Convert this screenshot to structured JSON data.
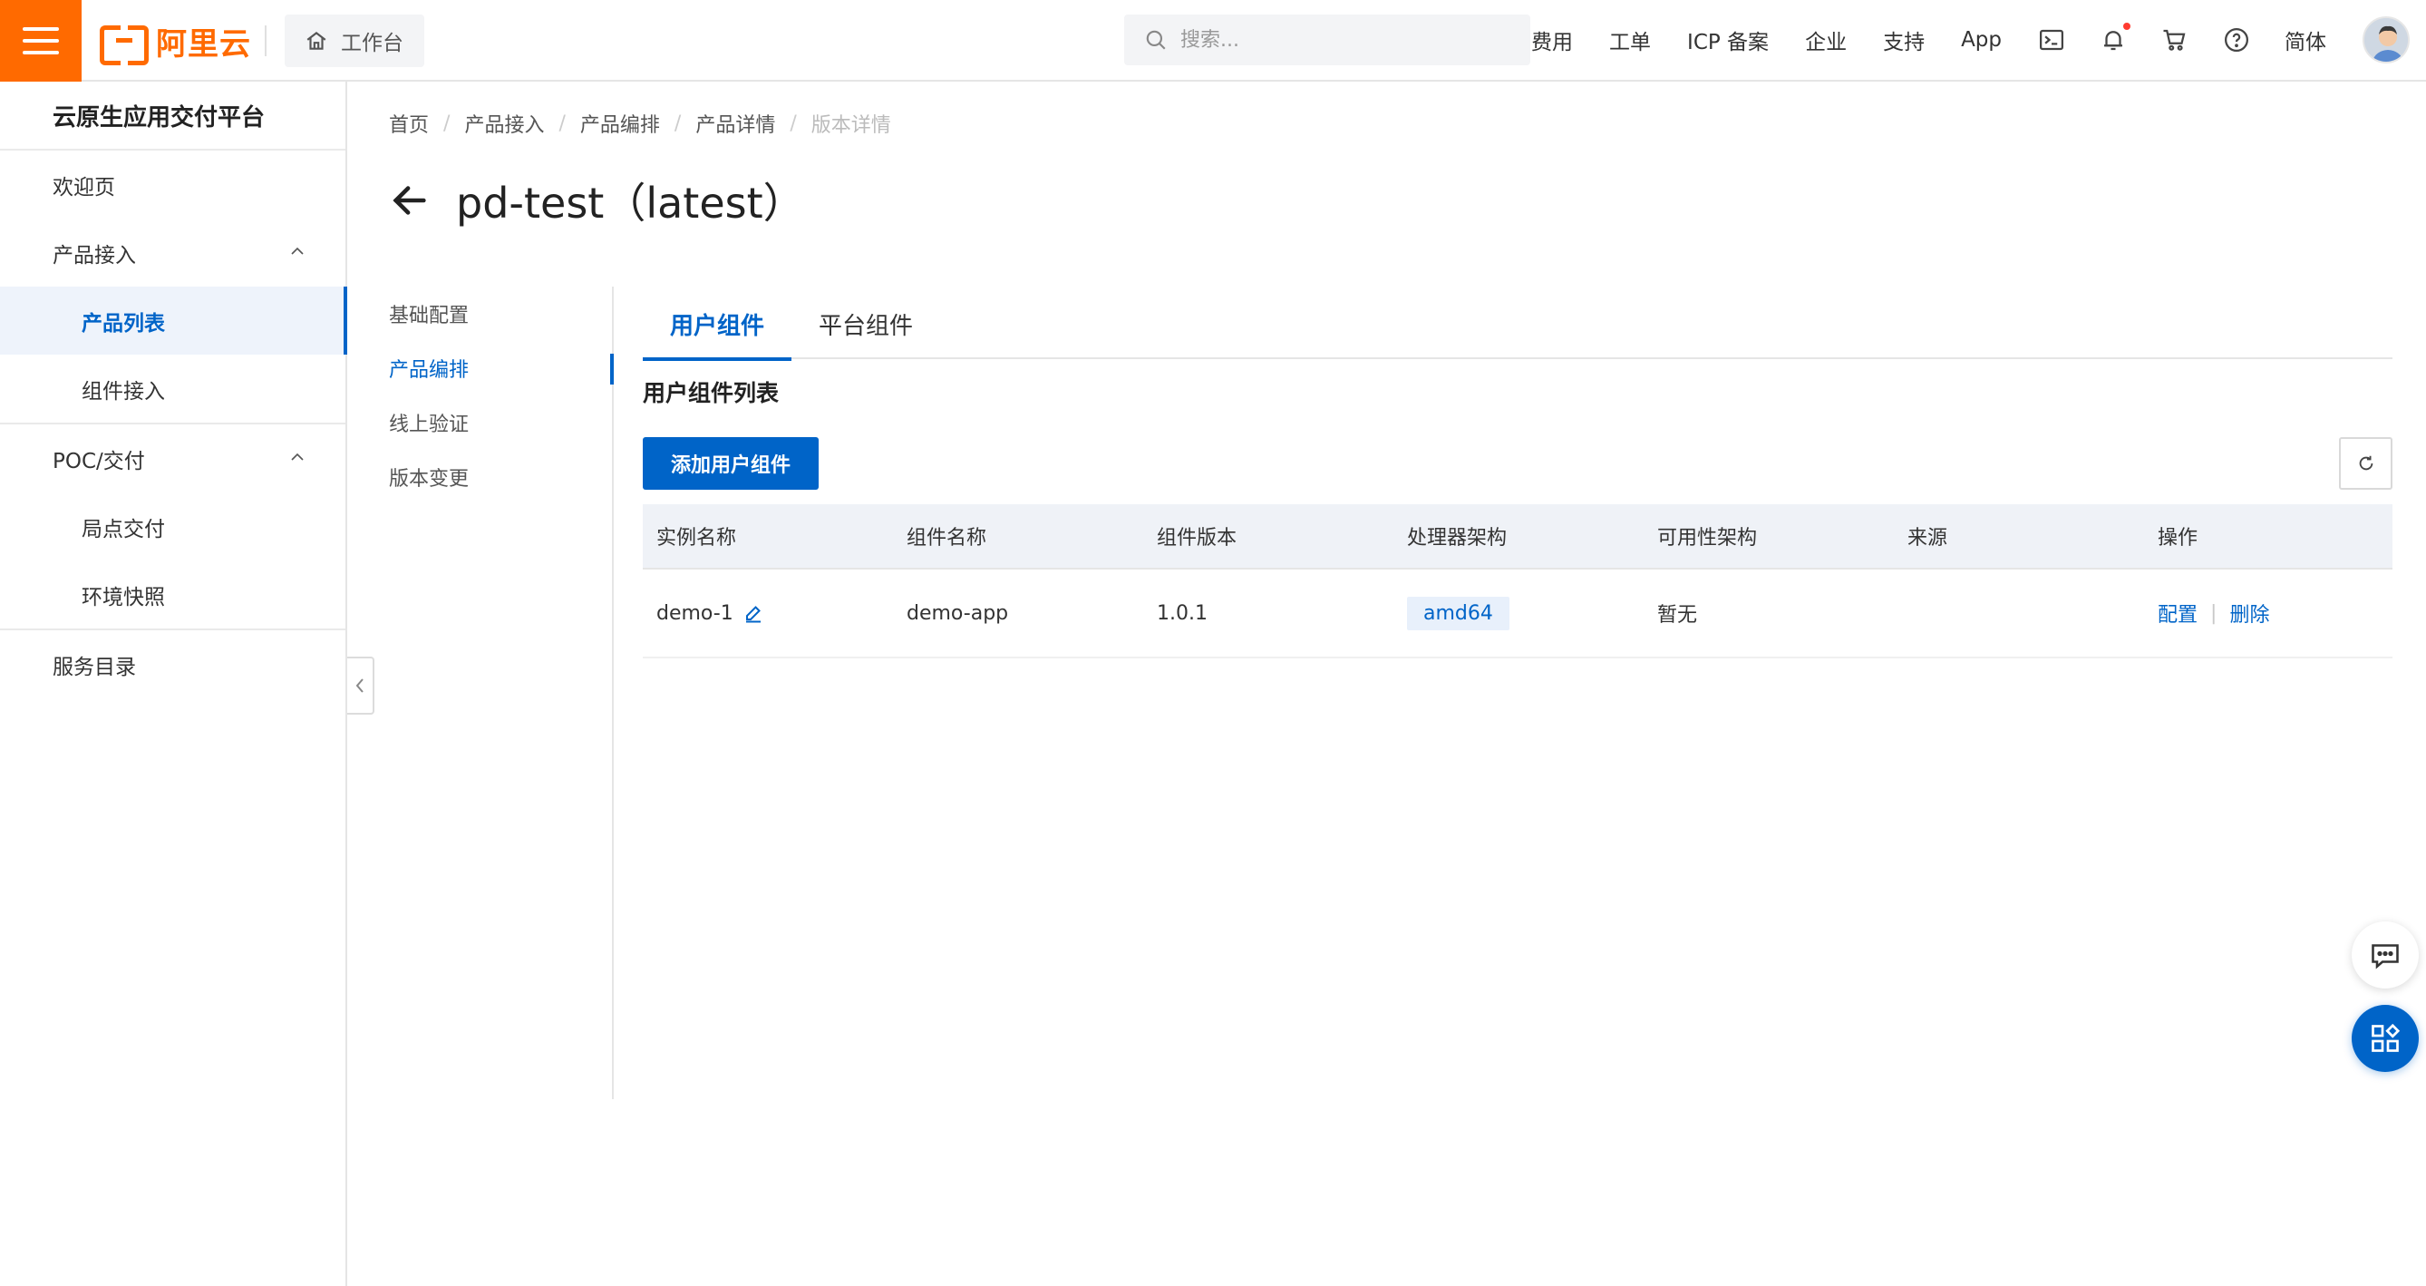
{
  "topbar": {
    "logo_text": "阿里云",
    "workbench_label": "工作台",
    "search_placeholder": "搜索...",
    "links": [
      "费用",
      "工单",
      "ICP 备案",
      "企业",
      "支持",
      "App"
    ],
    "language": "简体"
  },
  "sidebar": {
    "title": "云原生应用交付平台",
    "welcome": "欢迎页",
    "group_product": "产品接入",
    "product_list": "产品列表",
    "component_access": "组件接入",
    "group_poc": "POC/交付",
    "site_delivery": "局点交付",
    "env_snapshot": "环境快照",
    "service_catalog": "服务目录"
  },
  "breadcrumb": [
    "首页",
    "产品接入",
    "产品编排",
    "产品详情",
    "版本详情"
  ],
  "page": {
    "title": "pd-test（latest）"
  },
  "inner_nav": [
    "基础配置",
    "产品编排",
    "线上验证",
    "版本变更"
  ],
  "tabs": [
    "用户组件",
    "平台组件"
  ],
  "section": {
    "title": "用户组件列表",
    "add_button": "添加用户组件"
  },
  "table": {
    "columns": [
      "实例名称",
      "组件名称",
      "组件版本",
      "处理器架构",
      "可用性架构",
      "来源",
      "操作"
    ],
    "rows": [
      {
        "instance": "demo-1",
        "component": "demo-app",
        "version": "1.0.1",
        "arch": "amd64",
        "availability": "暂无",
        "source": "",
        "op_config": "配置",
        "op_delete": "删除"
      }
    ]
  },
  "colors": {
    "brand_orange": "#ff6a00",
    "primary_blue": "#0064c8"
  }
}
